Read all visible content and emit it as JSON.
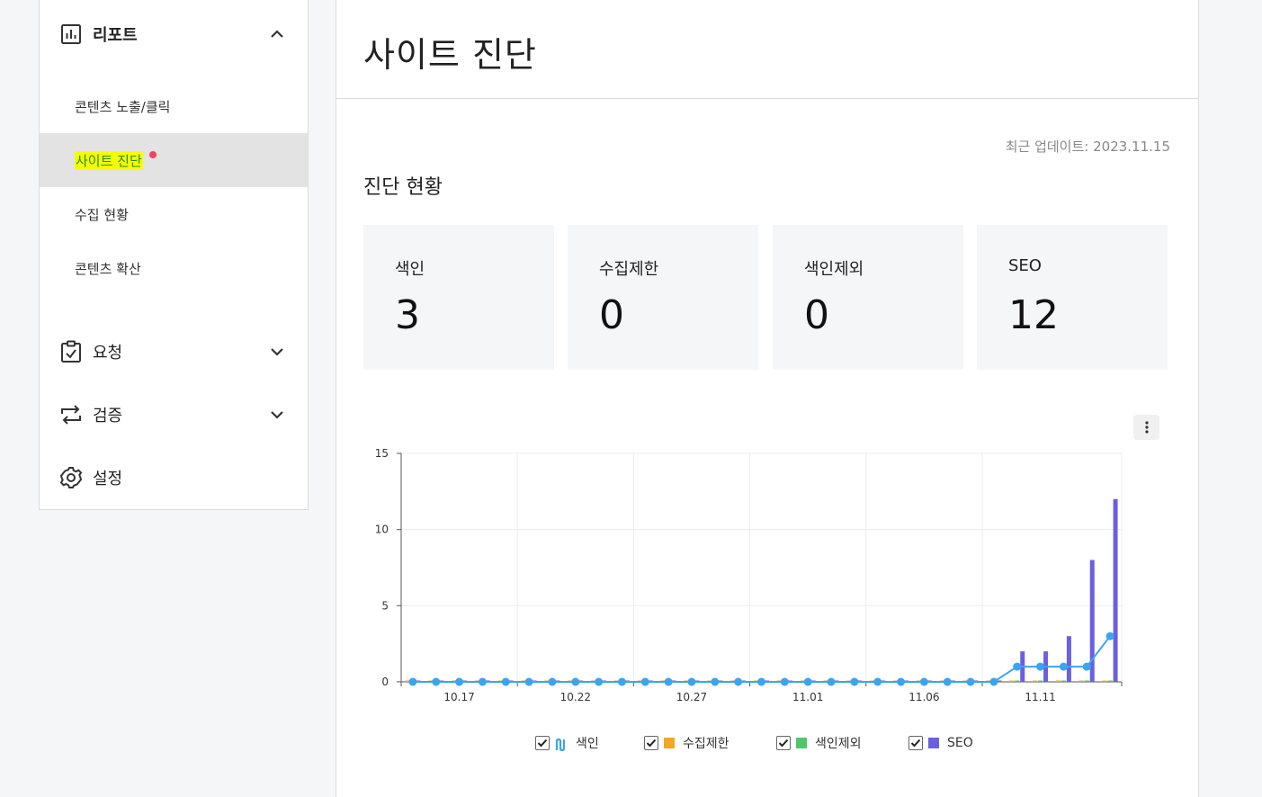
{
  "sidebar": {
    "report": {
      "label": "리포트"
    },
    "report_items": [
      {
        "label": "콘텐츠 노출/클릭"
      },
      {
        "label": "사이트 진단"
      },
      {
        "label": "수집 현황"
      },
      {
        "label": "콘텐츠 확산"
      }
    ],
    "request": {
      "label": "요청"
    },
    "verify": {
      "label": "검증"
    },
    "settings": {
      "label": "설정"
    }
  },
  "main": {
    "title": "사이트 진단",
    "updated": "최근 업데이트: 2023.11.15",
    "section_title": "진단 현황",
    "cards": [
      {
        "label": "색인",
        "value": "3"
      },
      {
        "label": "수집제한",
        "value": "0"
      },
      {
        "label": "색인제외",
        "value": "0"
      },
      {
        "label": "SEO",
        "value": "12"
      }
    ]
  },
  "chart_data": {
    "type": "bar",
    "x": [
      "10.15",
      "10.16",
      "10.17",
      "10.18",
      "10.19",
      "10.20",
      "10.21",
      "10.22",
      "10.23",
      "10.24",
      "10.25",
      "10.26",
      "10.27",
      "10.28",
      "10.29",
      "10.30",
      "10.31",
      "11.01",
      "11.02",
      "11.03",
      "11.04",
      "11.05",
      "11.06",
      "11.07",
      "11.08",
      "11.09",
      "11.10",
      "11.11",
      "11.12",
      "11.13",
      "11.14"
    ],
    "xticks": [
      "10.17",
      "10.22",
      "10.27",
      "11.01",
      "11.06",
      "11.11"
    ],
    "yticks": [
      "0",
      "5",
      "10",
      "15"
    ],
    "ylim": [
      0,
      15
    ],
    "series": [
      {
        "name": "색인",
        "kind": "line",
        "color": "#3ba4f0",
        "values": [
          0,
          0,
          0,
          0,
          0,
          0,
          0,
          0,
          0,
          0,
          0,
          0,
          0,
          0,
          0,
          0,
          0,
          0,
          0,
          0,
          0,
          0,
          0,
          0,
          0,
          0,
          1,
          1,
          1,
          1,
          3
        ]
      },
      {
        "name": "수집제한",
        "kind": "bar",
        "color": "#f5a623",
        "values": [
          0,
          0,
          0,
          0,
          0,
          0,
          0,
          0,
          0,
          0,
          0,
          0,
          0,
          0,
          0,
          0,
          0,
          0,
          0,
          0,
          0,
          0,
          0,
          0,
          0,
          0,
          0,
          0,
          0,
          0,
          0
        ]
      },
      {
        "name": "색인제외",
        "kind": "bar",
        "color": "#4cc86b",
        "values": [
          0,
          0,
          0,
          0,
          0,
          0,
          0,
          0,
          0,
          0,
          0,
          0,
          0,
          0,
          0,
          0,
          0,
          0,
          0,
          0,
          0,
          0,
          0,
          0,
          0,
          0,
          0,
          0,
          0,
          0,
          0
        ]
      },
      {
        "name": "SEO",
        "kind": "bar",
        "color": "#6b5fe0",
        "values": [
          0,
          0,
          0,
          0,
          0,
          0,
          0,
          0,
          0,
          0,
          0,
          0,
          0,
          0,
          0,
          0,
          0,
          0,
          0,
          0,
          0,
          0,
          0,
          0,
          0,
          0,
          2,
          2,
          3,
          8,
          12
        ]
      }
    ],
    "grid": true,
    "legend": "bottom"
  }
}
